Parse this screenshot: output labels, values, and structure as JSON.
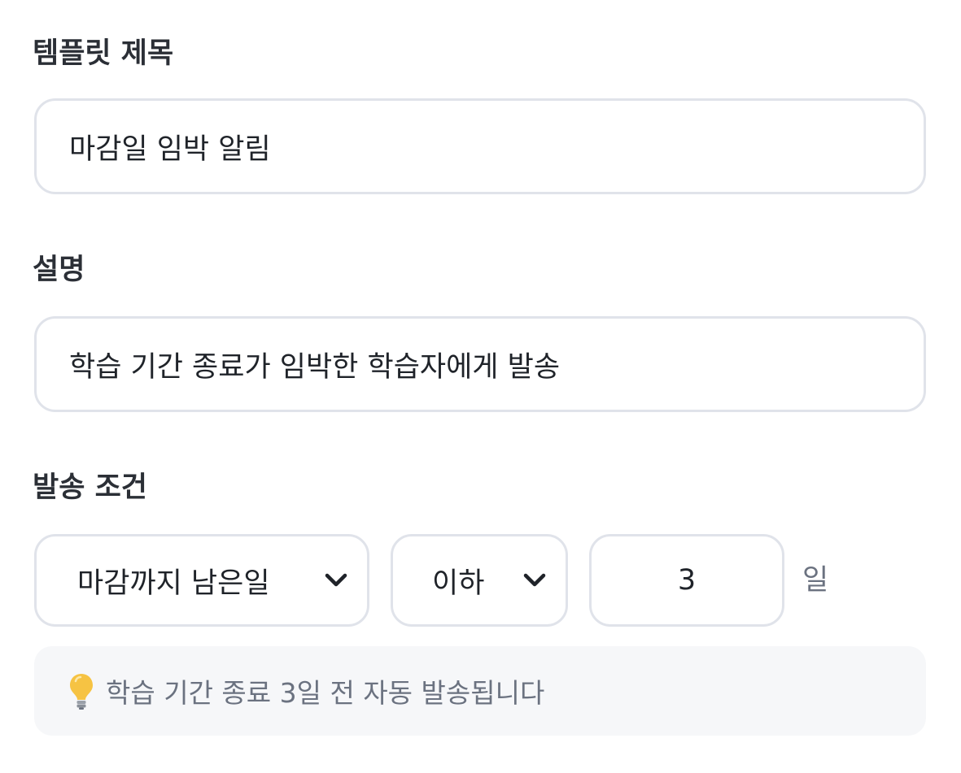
{
  "title_section": {
    "label": "템플릿 제목",
    "value": "마감일 임박 알림"
  },
  "description_section": {
    "label": "설명",
    "value": "학습 기간 종료가 임박한 학습자에게 발송"
  },
  "condition_section": {
    "label": "발송 조건",
    "field_select": {
      "value": "마감까지 남은일",
      "icon": "chevron-down-icon"
    },
    "operator_select": {
      "value": "이하",
      "icon": "chevron-down-icon"
    },
    "number_value": "3",
    "unit_label": "일"
  },
  "hint": {
    "icon": "lightbulb-icon",
    "text": "학습 기간 종료 3일 전 자동 발송됩니다"
  },
  "colors": {
    "border": "#e0e3ea",
    "label_text": "#2b2f36",
    "value_text": "#1f2329",
    "muted_text": "#6b7280",
    "hint_background": "#f6f7f9",
    "bulb": "#f6c343"
  }
}
